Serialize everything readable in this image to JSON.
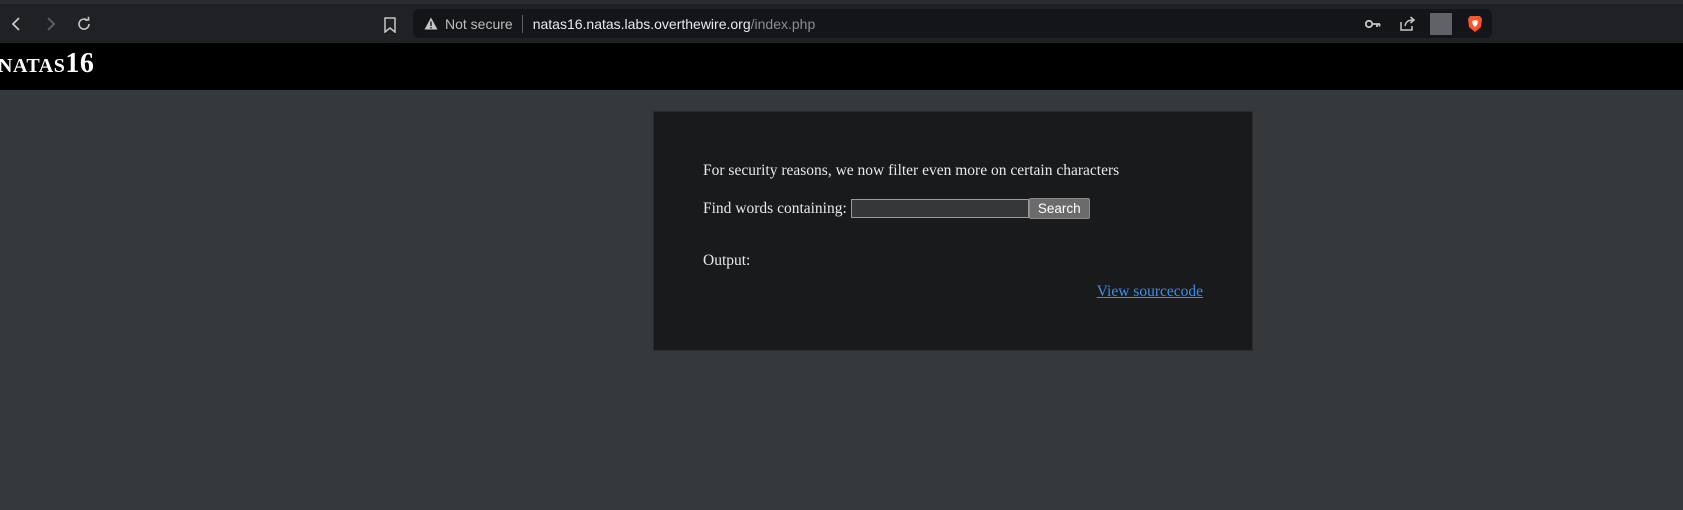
{
  "browser": {
    "security_label": "Not secure",
    "url_host": "natas16.natas.labs.overthewire.org",
    "url_path": "/index.php"
  },
  "header": {
    "title": "natas16"
  },
  "main": {
    "intro_text": "For security reasons, we now filter even more on certain characters",
    "find_label": "Find words containing:",
    "search_input_value": "",
    "search_button_label": "Search",
    "output_label": "Output:",
    "source_link_label": "View sourcecode"
  },
  "colors": {
    "page_bg": "#35393c",
    "header_bg": "#000000",
    "content_bg": "#191a1c",
    "link": "#3b8ef0",
    "brave_accent": "#fb542b"
  },
  "icons": {
    "back": "back-arrow-icon",
    "forward": "forward-arrow-icon",
    "reload": "reload-icon",
    "bookmark": "bookmark-icon",
    "warning": "warning-icon",
    "key": "key-icon",
    "share": "share-icon",
    "brave": "brave-shield-icon"
  }
}
